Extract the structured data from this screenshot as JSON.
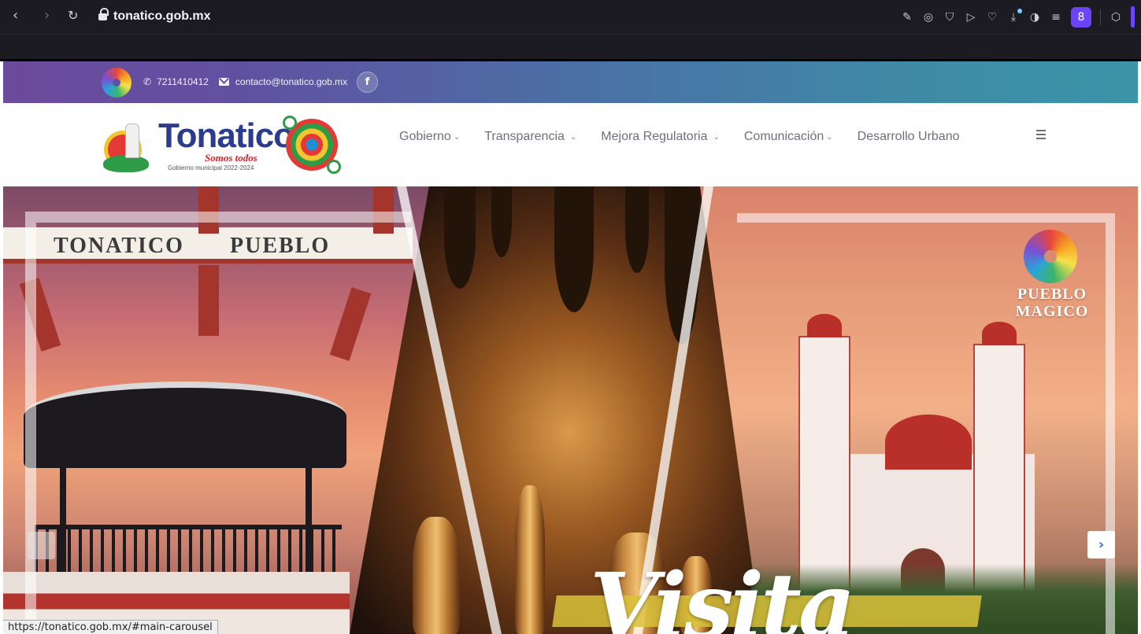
{
  "browser": {
    "url": "tonatico.gob.mx",
    "status_url": "https://tonatico.gob.mx/#main-carousel",
    "profile_initial": "8",
    "nav_icons": [
      "back-icon",
      "forward-icon",
      "reload-icon"
    ],
    "toolbar_icons": [
      "edit-icon",
      "camera-icon",
      "shield-icon",
      "send-icon",
      "heart-icon",
      "download-icon",
      "theme-toggle-icon",
      "menu-sliders-icon",
      "profile-icon",
      "extension-cube-icon"
    ]
  },
  "topbar": {
    "phone": "7211410412",
    "email": "contacto@tonatico.gob.mx",
    "facebook_label": "f"
  },
  "header": {
    "logo_name": "Tonatico",
    "logo_tagline": "Somos todos",
    "logo_term": "Gobierno municipal 2022-2024",
    "nav": [
      {
        "label": "Gobierno",
        "dropdown": true
      },
      {
        "label": "Transparencia",
        "dropdown": true
      },
      {
        "label": "Mejora Regulatoria",
        "dropdown": true
      },
      {
        "label": "Comunicación",
        "dropdown": true
      },
      {
        "label": "Desarrollo Urbano",
        "dropdown": false
      }
    ]
  },
  "hero": {
    "sign_left": "TONATICO",
    "sign_right": "PUEBLO",
    "pueblo_line1": "PUEBLO",
    "pueblo_line2": "MAGICO",
    "headline": "Visita",
    "next_symbol": "›",
    "prev_symbol": "‹"
  },
  "colors": {
    "topbar_start": "#6c4a9c",
    "topbar_end": "#3b94a8",
    "nav_text": "#6d6f80",
    "accent_red": "#b92f2a",
    "browser_profile": "#6d44f5"
  }
}
